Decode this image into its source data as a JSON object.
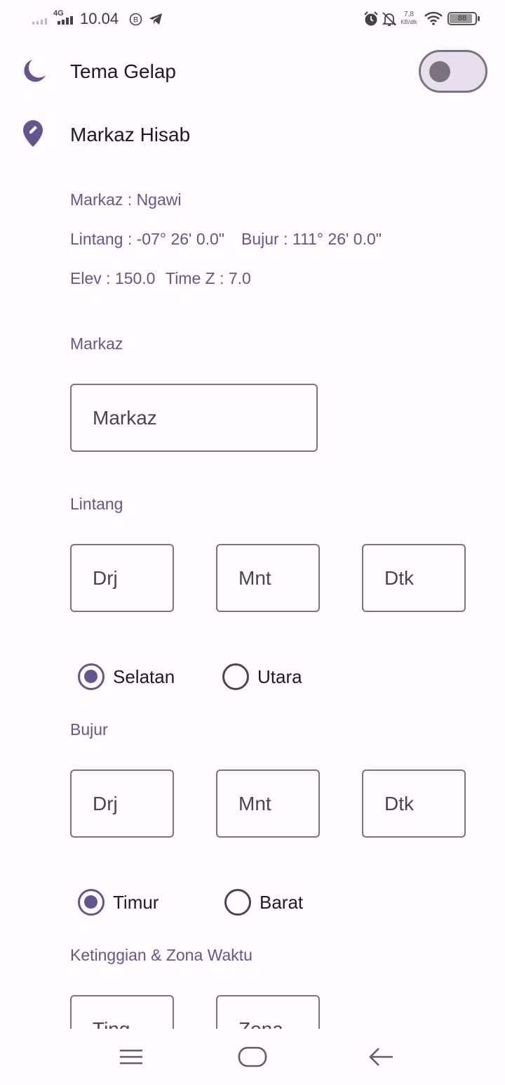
{
  "status_bar": {
    "network": "4G",
    "time": "10.04",
    "speed_value": "7,8",
    "speed_unit": "KB/dtk",
    "battery": "88"
  },
  "settings": {
    "dark_theme_label": "Tema Gelap",
    "dark_theme_enabled": false,
    "markaz_hisab_label": "Markaz Hisab"
  },
  "info": {
    "markaz": "Markaz : Ngawi",
    "lintang": "Lintang : -07° 26' 0.0\"",
    "bujur": "Bujur : 111° 26' 0.0\"",
    "elev": "Elev : 150.0",
    "timez": "Time Z : 7.0"
  },
  "form": {
    "markaz_section": "Markaz",
    "markaz_placeholder": "Markaz",
    "lintang_section": "Lintang",
    "lintang_fields": [
      "Drj",
      "Mnt",
      "Dtk"
    ],
    "lintang_options": [
      {
        "label": "Selatan",
        "selected": true
      },
      {
        "label": "Utara",
        "selected": false
      }
    ],
    "bujur_section": "Bujur",
    "bujur_fields": [
      "Drj",
      "Mnt",
      "Dtk"
    ],
    "bujur_options": [
      {
        "label": "Timur",
        "selected": true
      },
      {
        "label": "Barat",
        "selected": false
      }
    ],
    "elev_section": "Ketinggian & Zona Waktu",
    "elev_fields": [
      "Ting...",
      "Zona..."
    ]
  },
  "colors": {
    "accent": "#65558f",
    "background": "#fffbfe",
    "outline": "#79747e"
  },
  "icons": {
    "theme": "moon-icon",
    "location": "location-edit-icon",
    "nav_menu": "menu-icon",
    "nav_home": "home-icon",
    "nav_back": "back-arrow-icon"
  }
}
